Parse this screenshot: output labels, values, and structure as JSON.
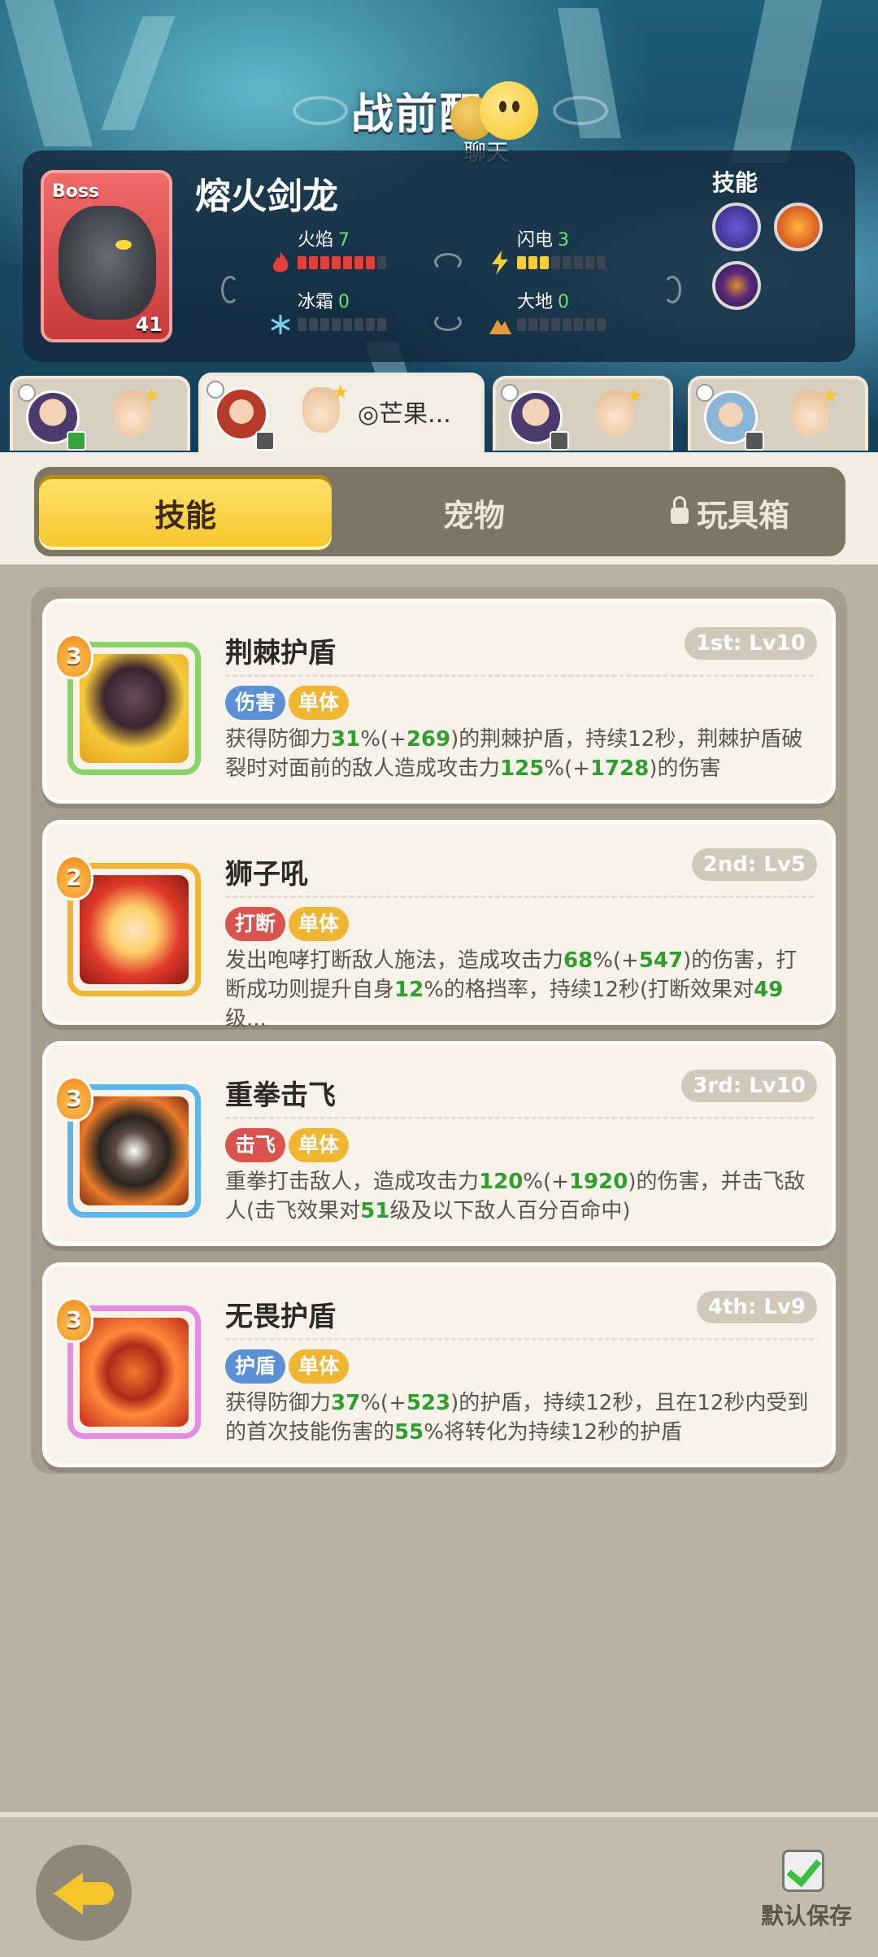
{
  "header": {
    "title": "战前配置",
    "chat_label": "聊天"
  },
  "boss": {
    "tag": "Boss",
    "level": "41",
    "name": "熔火剑龙",
    "skills_label": "技能",
    "stats": [
      {
        "label": "火焰",
        "value": "7",
        "filled": 7,
        "total": 8,
        "color": "#e2413a",
        "icon": "fire-icon"
      },
      {
        "label": "闪电",
        "value": "3",
        "filled": 3,
        "total": 8,
        "color": "#f3cf3a",
        "icon": "lightning-icon"
      },
      {
        "label": "冰霜",
        "value": "0",
        "filled": 0,
        "total": 8,
        "color": "#7fd0f0",
        "icon": "snowflake-icon"
      },
      {
        "label": "大地",
        "value": "0",
        "filled": 0,
        "total": 8,
        "color": "#e39a3a",
        "icon": "earth-icon"
      }
    ],
    "skill_icons": [
      "lightning-swirl-skill-icon",
      "fire-skill-icon",
      "dark-skill-icon"
    ]
  },
  "hero_tabs": [
    {
      "name": "",
      "active": false
    },
    {
      "name": "◎芒果...",
      "active": true
    },
    {
      "name": "",
      "active": false
    },
    {
      "name": "",
      "active": false
    }
  ],
  "segments": {
    "skills": "技能",
    "pets": "宠物",
    "toybox": "玩具箱"
  },
  "skills": [
    {
      "level": "3",
      "name": "荆棘护盾",
      "slot": "1st: Lv10",
      "tags": [
        {
          "text": "伤害",
          "color": "#5b8fd6"
        },
        {
          "text": "单体",
          "color": "#f0b631"
        }
      ],
      "desc": [
        "获得防御力",
        "31",
        "%(+",
        "269",
        ")的荆棘护盾，持续12秒，荆棘护盾破裂时对面前的敌人造成攻击力",
        "125",
        "%(+",
        "1728",
        ")的伤害"
      ],
      "frame_color": "#86d46a"
    },
    {
      "level": "2",
      "name": "狮子吼",
      "slot": "2nd: Lv5",
      "tags": [
        {
          "text": "打断",
          "color": "#d9534f"
        },
        {
          "text": "单体",
          "color": "#f0b631"
        }
      ],
      "desc": [
        "发出咆哮打断敌人施法，造成攻击力",
        "68",
        "%(+",
        "547",
        ")的伤害，打断成功则提升自身",
        "12",
        "%的格挡率，持续12秒(打断效果对",
        "49",
        "级..."
      ],
      "frame_color": "#f0b631"
    },
    {
      "level": "3",
      "name": "重拳击飞",
      "slot": "3rd: Lv10",
      "tags": [
        {
          "text": "击飞",
          "color": "#d9534f"
        },
        {
          "text": "单体",
          "color": "#f0b631"
        }
      ],
      "desc": [
        "重拳打击敌人，造成攻击力",
        "120",
        "%(+",
        "1920",
        ")的伤害，并击飞敌人(击飞效果对",
        "51",
        "级及以下敌人百分百命中)"
      ],
      "frame_color": "#5fb4ec"
    },
    {
      "level": "3",
      "name": "无畏护盾",
      "slot": "4th: Lv9",
      "tags": [
        {
          "text": "护盾",
          "color": "#5b8fd6"
        },
        {
          "text": "单体",
          "color": "#f0b631"
        }
      ],
      "desc": [
        "获得防御力",
        "37",
        "%(+",
        "523",
        ")的护盾，持续12秒，且在12秒内受到的首次技能伤害的",
        "55",
        "%将转化为持续12秒的护盾"
      ],
      "frame_color": "#e68be0"
    }
  ],
  "footer": {
    "save_label": "默认保存"
  }
}
